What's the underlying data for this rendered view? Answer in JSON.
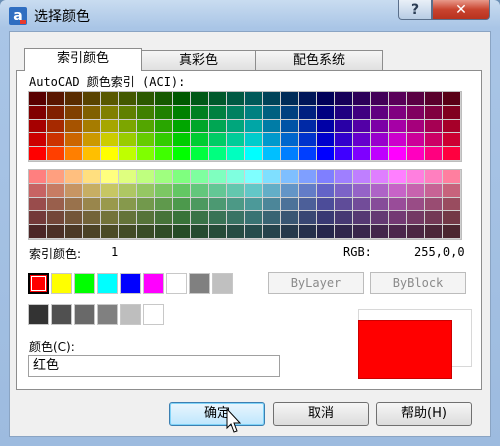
{
  "window": {
    "title": "选择颜色",
    "help_glyph": "?",
    "close_glyph": "✕",
    "app_icon_letter": "a"
  },
  "tabs": [
    "索引颜色",
    "真彩色",
    "配色系统"
  ],
  "aci": {
    "label": "AutoCAD 颜色索引 (ACI):",
    "index_label": "索引颜色:",
    "index_value": "1",
    "rgb_label": "RGB:",
    "rgb_value": "255,0,0"
  },
  "palette": {
    "hues": [
      "#ff0000",
      "#ff3f00",
      "#ff7f00",
      "#ffbf00",
      "#ffff00",
      "#bfff00",
      "#7fff00",
      "#3fff00",
      "#00ff00",
      "#00ff3f",
      "#00ff7f",
      "#00ffbf",
      "#00ffff",
      "#00bfff",
      "#007fff",
      "#003fff",
      "#0000ff",
      "#3f00ff",
      "#7f00ff",
      "#bf00ff",
      "#ff00ff",
      "#ff00bf",
      "#ff007f",
      "#ff003f"
    ]
  },
  "standard_colors": [
    "#ff0000",
    "#ffff00",
    "#00ff00",
    "#00ffff",
    "#0000ff",
    "#ff00ff",
    "#ffffff",
    "#808080",
    "#c0c0c0"
  ],
  "gray_colors": [
    "#333333",
    "#505050",
    "#696969",
    "#808080",
    "#bebebe",
    "#ffffff"
  ],
  "buttons": {
    "bylayer": "ByLayer",
    "byblock": "ByBlock",
    "ok": "确定",
    "cancel": "取消",
    "help": "帮助(H)"
  },
  "color_field": {
    "label": "颜色(C):",
    "value": "红色"
  },
  "preview": {
    "new_color": "#ff0000"
  }
}
